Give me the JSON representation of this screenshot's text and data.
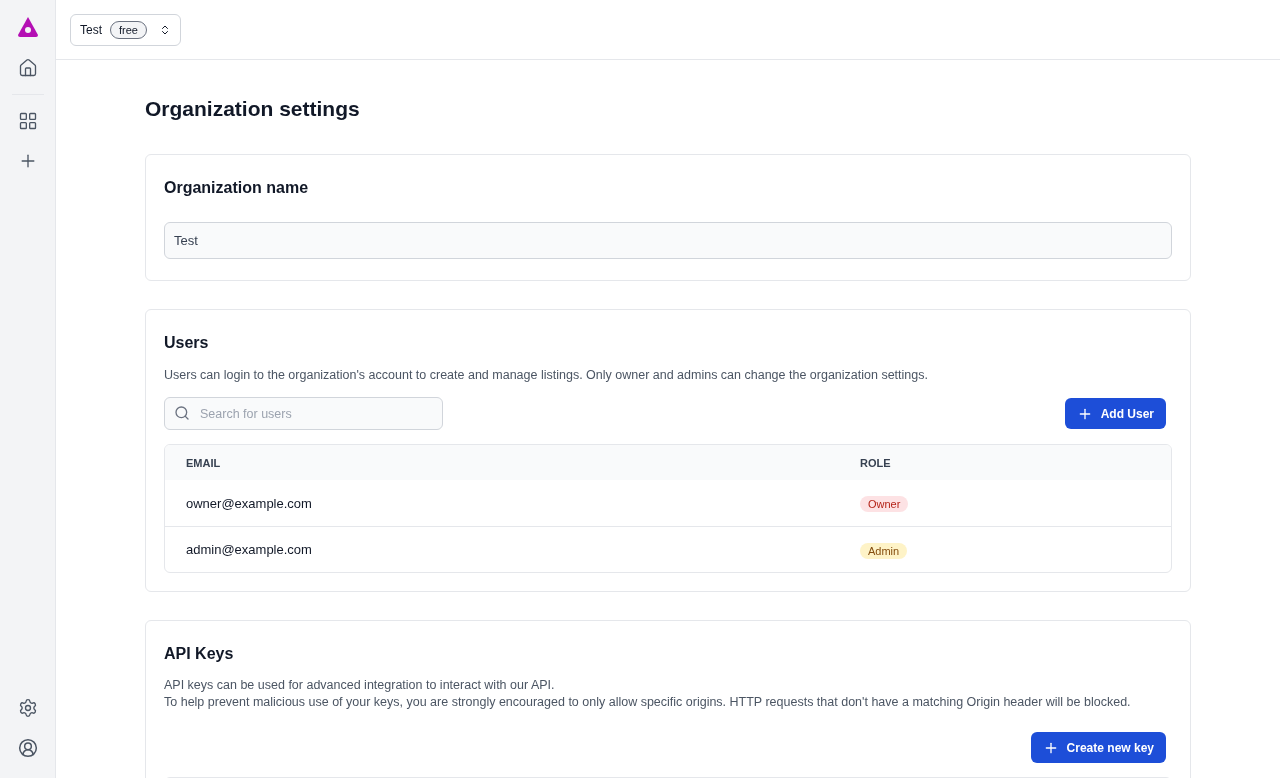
{
  "org_switcher": {
    "name": "Test",
    "plan": "free"
  },
  "page_title": "Organization settings",
  "org_name_card": {
    "title": "Organization name",
    "value": "Test"
  },
  "users_card": {
    "title": "Users",
    "description": "Users can login to the organization's account to create and manage listings. Only owner and admins can change the organization settings.",
    "search": {
      "placeholder": "Search for users"
    },
    "add_button": "Add User",
    "columns": [
      "EMAIL",
      "ROLE"
    ],
    "rows": [
      {
        "email": "owner@example.com",
        "role": "Owner",
        "kind": "owner"
      },
      {
        "email": "admin@example.com",
        "role": "Admin",
        "kind": "admin"
      }
    ]
  },
  "api_card": {
    "title": "API Keys",
    "description_lines": [
      "API keys can be used for advanced integration to interact with our API.",
      "To help prevent malicious use of your keys, you are strongly encouraged to only allow specific origins. HTTP requests that don't have a matching Origin header will be blocked."
    ],
    "create_button": "Create new key"
  }
}
